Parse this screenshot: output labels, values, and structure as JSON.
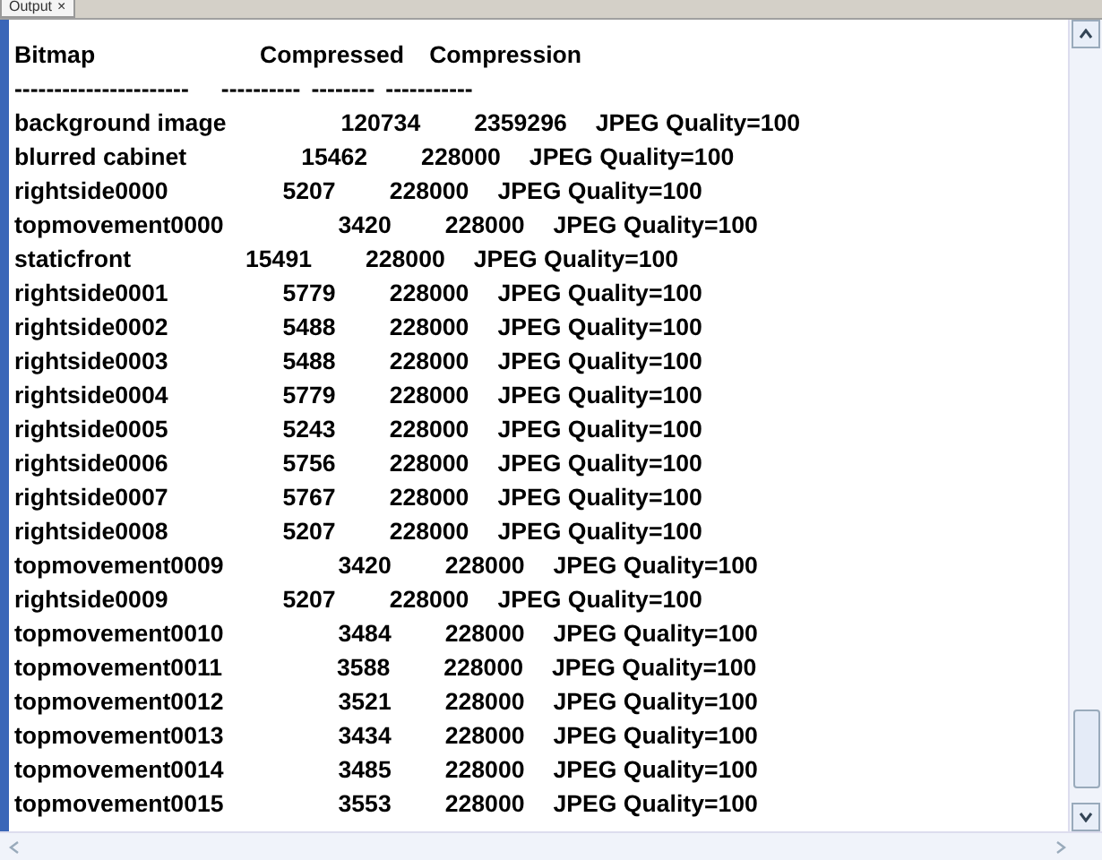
{
  "tab": {
    "label": "Output",
    "close": "×"
  },
  "header": [
    "Bitmap",
    "Compressed",
    "Compression"
  ],
  "rule": [
    "----------------------",
    "----------",
    "--------",
    "-----------"
  ],
  "rows": [
    {
      "name": "background image",
      "compressed": "120734",
      "size": "2359296",
      "compression": "JPEG Quality=100"
    },
    {
      "name": "blurred cabinet",
      "compressed": "15462",
      "size": "228000",
      "compression": "JPEG Quality=100"
    },
    {
      "name": "rightside0000",
      "compressed": "5207",
      "size": "228000",
      "compression": "JPEG Quality=100"
    },
    {
      "name": "topmovement0000",
      "compressed": "3420",
      "size": "228000",
      "compression": "JPEG Quality=100"
    },
    {
      "name": "staticfront",
      "compressed": "15491",
      "size": "228000",
      "compression": "JPEG Quality=100"
    },
    {
      "name": "rightside0001",
      "compressed": "5779",
      "size": "228000",
      "compression": "JPEG Quality=100"
    },
    {
      "name": "rightside0002",
      "compressed": "5488",
      "size": "228000",
      "compression": "JPEG Quality=100"
    },
    {
      "name": "rightside0003",
      "compressed": "5488",
      "size": "228000",
      "compression": "JPEG Quality=100"
    },
    {
      "name": "rightside0004",
      "compressed": "5779",
      "size": "228000",
      "compression": "JPEG Quality=100"
    },
    {
      "name": "rightside0005",
      "compressed": "5243",
      "size": "228000",
      "compression": "JPEG Quality=100"
    },
    {
      "name": "rightside0006",
      "compressed": "5756",
      "size": "228000",
      "compression": "JPEG Quality=100"
    },
    {
      "name": "rightside0007",
      "compressed": "5767",
      "size": "228000",
      "compression": "JPEG Quality=100"
    },
    {
      "name": "rightside0008",
      "compressed": "5207",
      "size": "228000",
      "compression": "JPEG Quality=100"
    },
    {
      "name": "topmovement0009",
      "compressed": "3420",
      "size": "228000",
      "compression": "JPEG Quality=100"
    },
    {
      "name": "rightside0009",
      "compressed": "5207",
      "size": "228000",
      "compression": "JPEG Quality=100"
    },
    {
      "name": "topmovement0010",
      "compressed": "3484",
      "size": "228000",
      "compression": "JPEG Quality=100"
    },
    {
      "name": "topmovement0011",
      "compressed": "3588",
      "size": "228000",
      "compression": "JPEG Quality=100"
    },
    {
      "name": "topmovement0012",
      "compressed": "3521",
      "size": "228000",
      "compression": "JPEG Quality=100"
    },
    {
      "name": "topmovement0013",
      "compressed": "3434",
      "size": "228000",
      "compression": "JPEG Quality=100"
    },
    {
      "name": "topmovement0014",
      "compressed": "3485",
      "size": "228000",
      "compression": "JPEG Quality=100"
    },
    {
      "name": "topmovement0015",
      "compressed": "3553",
      "size": "228000",
      "compression": "JPEG Quality=100"
    }
  ]
}
